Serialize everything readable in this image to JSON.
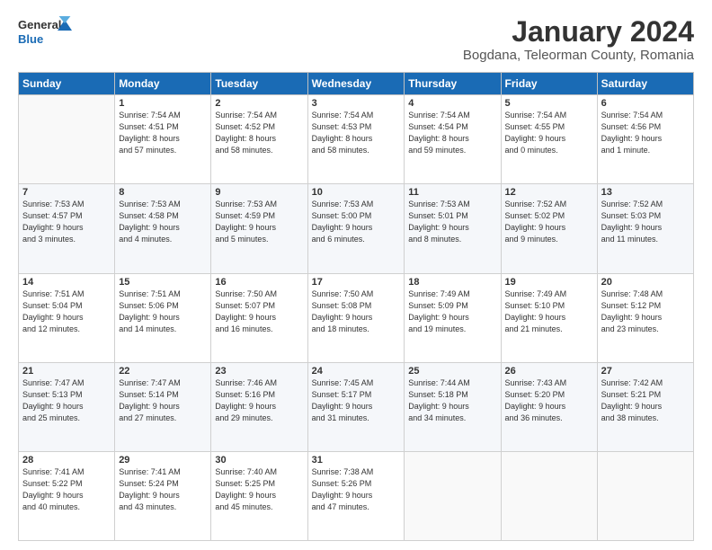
{
  "logo": {
    "line1": "General",
    "line2": "Blue"
  },
  "header": {
    "month": "January 2024",
    "location": "Bogdana, Teleorman County, Romania"
  },
  "weekdays": [
    "Sunday",
    "Monday",
    "Tuesday",
    "Wednesday",
    "Thursday",
    "Friday",
    "Saturday"
  ],
  "weeks": [
    [
      {
        "day": "",
        "info": ""
      },
      {
        "day": "1",
        "info": "Sunrise: 7:54 AM\nSunset: 4:51 PM\nDaylight: 8 hours\nand 57 minutes."
      },
      {
        "day": "2",
        "info": "Sunrise: 7:54 AM\nSunset: 4:52 PM\nDaylight: 8 hours\nand 58 minutes."
      },
      {
        "day": "3",
        "info": "Sunrise: 7:54 AM\nSunset: 4:53 PM\nDaylight: 8 hours\nand 58 minutes."
      },
      {
        "day": "4",
        "info": "Sunrise: 7:54 AM\nSunset: 4:54 PM\nDaylight: 8 hours\nand 59 minutes."
      },
      {
        "day": "5",
        "info": "Sunrise: 7:54 AM\nSunset: 4:55 PM\nDaylight: 9 hours\nand 0 minutes."
      },
      {
        "day": "6",
        "info": "Sunrise: 7:54 AM\nSunset: 4:56 PM\nDaylight: 9 hours\nand 1 minute."
      }
    ],
    [
      {
        "day": "7",
        "info": "Sunrise: 7:53 AM\nSunset: 4:57 PM\nDaylight: 9 hours\nand 3 minutes."
      },
      {
        "day": "8",
        "info": "Sunrise: 7:53 AM\nSunset: 4:58 PM\nDaylight: 9 hours\nand 4 minutes."
      },
      {
        "day": "9",
        "info": "Sunrise: 7:53 AM\nSunset: 4:59 PM\nDaylight: 9 hours\nand 5 minutes."
      },
      {
        "day": "10",
        "info": "Sunrise: 7:53 AM\nSunset: 5:00 PM\nDaylight: 9 hours\nand 6 minutes."
      },
      {
        "day": "11",
        "info": "Sunrise: 7:53 AM\nSunset: 5:01 PM\nDaylight: 9 hours\nand 8 minutes."
      },
      {
        "day": "12",
        "info": "Sunrise: 7:52 AM\nSunset: 5:02 PM\nDaylight: 9 hours\nand 9 minutes."
      },
      {
        "day": "13",
        "info": "Sunrise: 7:52 AM\nSunset: 5:03 PM\nDaylight: 9 hours\nand 11 minutes."
      }
    ],
    [
      {
        "day": "14",
        "info": "Sunrise: 7:51 AM\nSunset: 5:04 PM\nDaylight: 9 hours\nand 12 minutes."
      },
      {
        "day": "15",
        "info": "Sunrise: 7:51 AM\nSunset: 5:06 PM\nDaylight: 9 hours\nand 14 minutes."
      },
      {
        "day": "16",
        "info": "Sunrise: 7:50 AM\nSunset: 5:07 PM\nDaylight: 9 hours\nand 16 minutes."
      },
      {
        "day": "17",
        "info": "Sunrise: 7:50 AM\nSunset: 5:08 PM\nDaylight: 9 hours\nand 18 minutes."
      },
      {
        "day": "18",
        "info": "Sunrise: 7:49 AM\nSunset: 5:09 PM\nDaylight: 9 hours\nand 19 minutes."
      },
      {
        "day": "19",
        "info": "Sunrise: 7:49 AM\nSunset: 5:10 PM\nDaylight: 9 hours\nand 21 minutes."
      },
      {
        "day": "20",
        "info": "Sunrise: 7:48 AM\nSunset: 5:12 PM\nDaylight: 9 hours\nand 23 minutes."
      }
    ],
    [
      {
        "day": "21",
        "info": "Sunrise: 7:47 AM\nSunset: 5:13 PM\nDaylight: 9 hours\nand 25 minutes."
      },
      {
        "day": "22",
        "info": "Sunrise: 7:47 AM\nSunset: 5:14 PM\nDaylight: 9 hours\nand 27 minutes."
      },
      {
        "day": "23",
        "info": "Sunrise: 7:46 AM\nSunset: 5:16 PM\nDaylight: 9 hours\nand 29 minutes."
      },
      {
        "day": "24",
        "info": "Sunrise: 7:45 AM\nSunset: 5:17 PM\nDaylight: 9 hours\nand 31 minutes."
      },
      {
        "day": "25",
        "info": "Sunrise: 7:44 AM\nSunset: 5:18 PM\nDaylight: 9 hours\nand 34 minutes."
      },
      {
        "day": "26",
        "info": "Sunrise: 7:43 AM\nSunset: 5:20 PM\nDaylight: 9 hours\nand 36 minutes."
      },
      {
        "day": "27",
        "info": "Sunrise: 7:42 AM\nSunset: 5:21 PM\nDaylight: 9 hours\nand 38 minutes."
      }
    ],
    [
      {
        "day": "28",
        "info": "Sunrise: 7:41 AM\nSunset: 5:22 PM\nDaylight: 9 hours\nand 40 minutes."
      },
      {
        "day": "29",
        "info": "Sunrise: 7:41 AM\nSunset: 5:24 PM\nDaylight: 9 hours\nand 43 minutes."
      },
      {
        "day": "30",
        "info": "Sunrise: 7:40 AM\nSunset: 5:25 PM\nDaylight: 9 hours\nand 45 minutes."
      },
      {
        "day": "31",
        "info": "Sunrise: 7:38 AM\nSunset: 5:26 PM\nDaylight: 9 hours\nand 47 minutes."
      },
      {
        "day": "",
        "info": ""
      },
      {
        "day": "",
        "info": ""
      },
      {
        "day": "",
        "info": ""
      }
    ]
  ]
}
